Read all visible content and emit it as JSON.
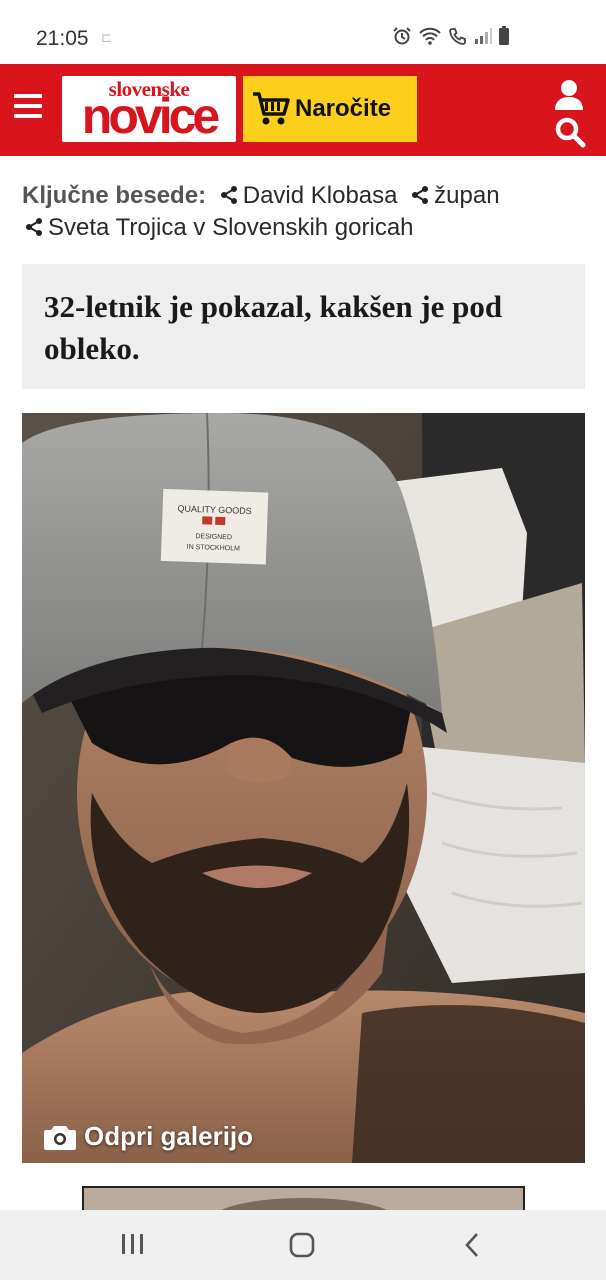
{
  "status_bar": {
    "time": "21:05",
    "small_indicator": "⊏"
  },
  "header": {
    "logo_top": "slovenske",
    "logo_main": "novice",
    "order_label": "Naročite",
    "brand_color": "#d8141c",
    "order_color": "#fbcf1c"
  },
  "keywords": {
    "label": "Ključne besede:",
    "items": [
      "David Klobasa",
      "župan",
      "Sveta Trojica v Slovenskih goricah"
    ]
  },
  "quote": {
    "text": "32-letnik je pokazal, kakšen je pod obleko."
  },
  "photo": {
    "cap_label_line1": "QUALITY GOODS",
    "cap_label_line2": "DESIGNED",
    "cap_label_line3": "IN STOCKHOLM",
    "gallery_label": "Odpri galerijo"
  },
  "icons": {
    "menu": "menu-icon",
    "cart": "cart-icon",
    "user": "user-icon",
    "search": "search-icon",
    "share": "share-icon",
    "camera": "camera-icon",
    "recents": "recents-icon",
    "home": "home-icon",
    "back": "back-icon"
  }
}
